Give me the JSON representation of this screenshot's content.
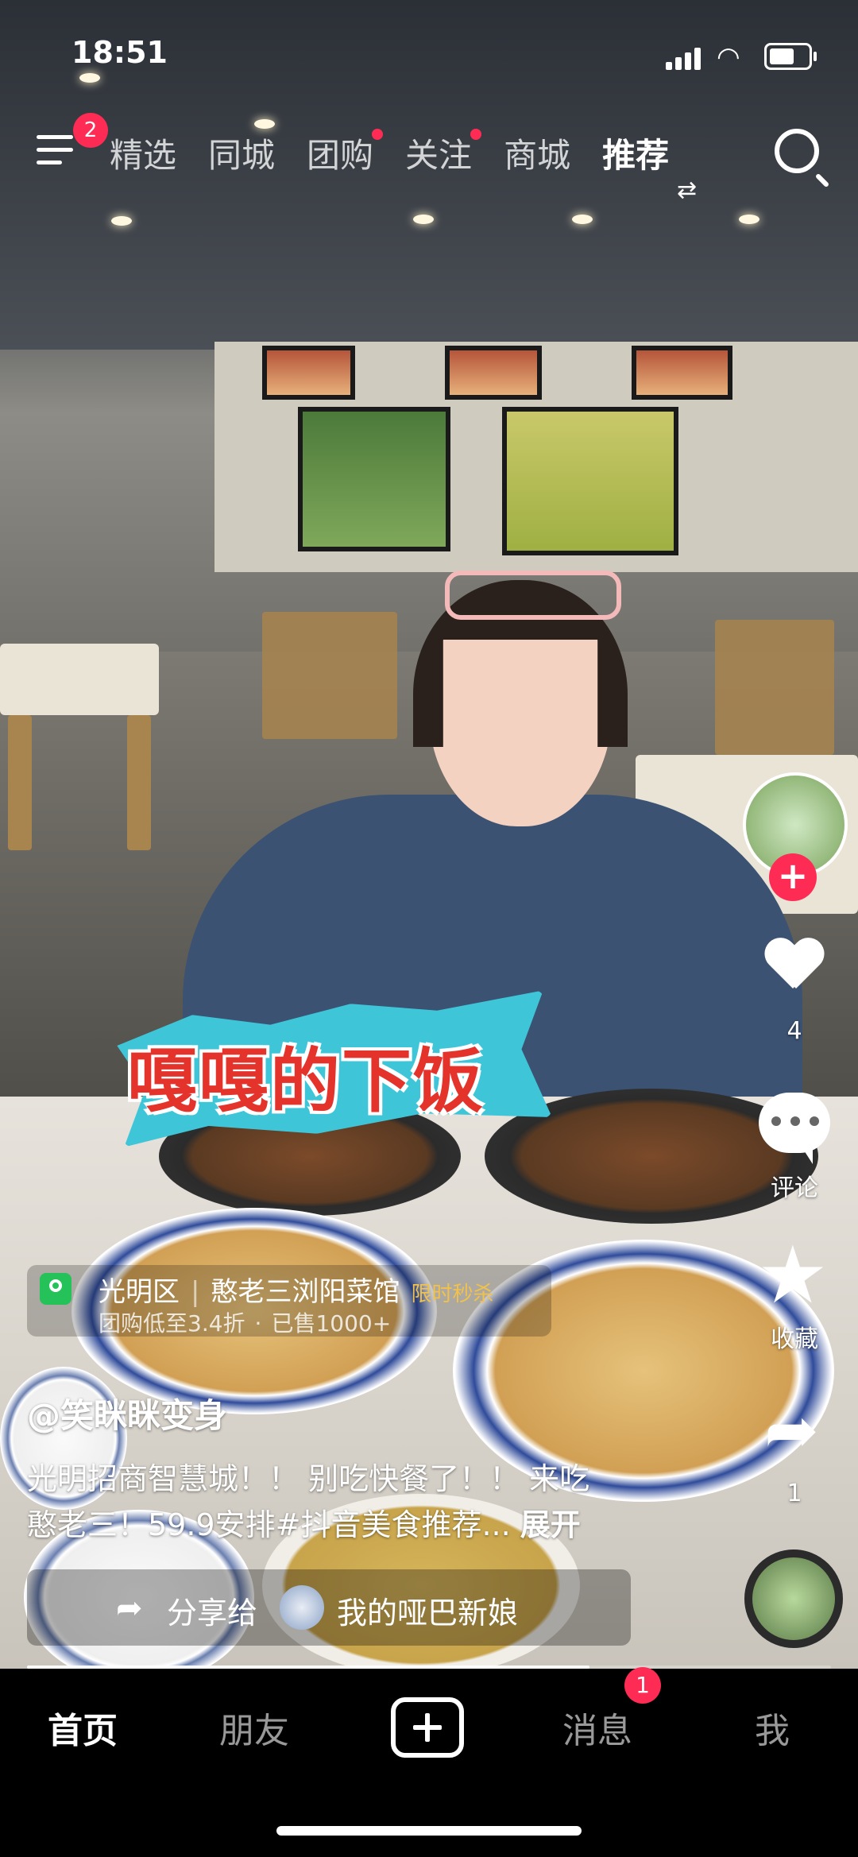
{
  "status_bar": {
    "time": "18:51"
  },
  "top_nav": {
    "menu_badge": "2",
    "tabs": [
      {
        "label": "精选",
        "dot": false,
        "active": false
      },
      {
        "label": "同城",
        "dot": false,
        "active": false
      },
      {
        "label": "团购",
        "dot": true,
        "active": false
      },
      {
        "label": "关注",
        "dot": true,
        "active": false
      },
      {
        "label": "商城",
        "dot": false,
        "active": false
      },
      {
        "label": "推荐",
        "dot": false,
        "active": true
      }
    ],
    "search_icon": "search-icon"
  },
  "overlay": {
    "sticker_text": "嘎嘎的下饭"
  },
  "actions": {
    "like_count": "4",
    "comment_label": "评论",
    "favorite_label": "收藏",
    "share_count": "1"
  },
  "poi": {
    "district": "光明区",
    "name": "憨老三浏阳菜馆",
    "tag": "限时秒杀",
    "discount": "团购低至3.4折",
    "sold": "已售1000+"
  },
  "video": {
    "author": "@笑眯眯变身",
    "description_line1": "光明招商智慧城！！ 别吃快餐了！！ 来吃",
    "description_line2": "憨老三！59.9安排#抖音美食推荐...",
    "more_label": "展开",
    "progress": 0.7
  },
  "share_bar": {
    "label": "分享给",
    "friend_name": "我的哑巴新娘"
  },
  "tab_bar": {
    "home": "首页",
    "friends": "朋友",
    "messages": "消息",
    "messages_badge": "1",
    "me": "我"
  }
}
